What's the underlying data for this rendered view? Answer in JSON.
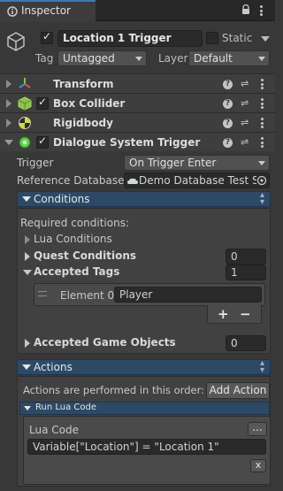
{
  "tab": {
    "title": "Inspector"
  },
  "object": {
    "name": "Location 1 Trigger",
    "static_label": "Static",
    "tag_label": "Tag",
    "tag_value": "Untagged",
    "layer_label": "Layer",
    "layer_value": "Default"
  },
  "components": [
    {
      "name": "Transform"
    },
    {
      "name": "Box Collider"
    },
    {
      "name": "Rigidbody"
    },
    {
      "name": "Dialogue System Trigger"
    }
  ],
  "trigger": {
    "trigger_label": "Trigger",
    "trigger_value": "On Trigger Enter",
    "refdb_label": "Reference Database",
    "refdb_value": "Demo Database Test S"
  },
  "conditions": {
    "header": "Conditions",
    "required_label": "Required conditions:",
    "lua_conditions": "Lua Conditions",
    "quest_conditions": "Quest Conditions",
    "quest_count": "0",
    "accepted_tags": "Accepted Tags",
    "accepted_tags_count": "1",
    "element_label": "Element 0",
    "element_value": "Player",
    "plus": "+",
    "minus": "−",
    "accepted_objects": "Accepted Game Objects",
    "accepted_objects_count": "0"
  },
  "actions": {
    "header": "Actions",
    "performed_label": "Actions are performed in this order:",
    "add_action": "Add Action",
    "run_lua_header": "Run Lua Code",
    "lua_code_label": "Lua Code",
    "ellipsis": "...",
    "lua_code_value": "Variable[\"Location\"] = \"Location 1\"",
    "remove": "x"
  }
}
